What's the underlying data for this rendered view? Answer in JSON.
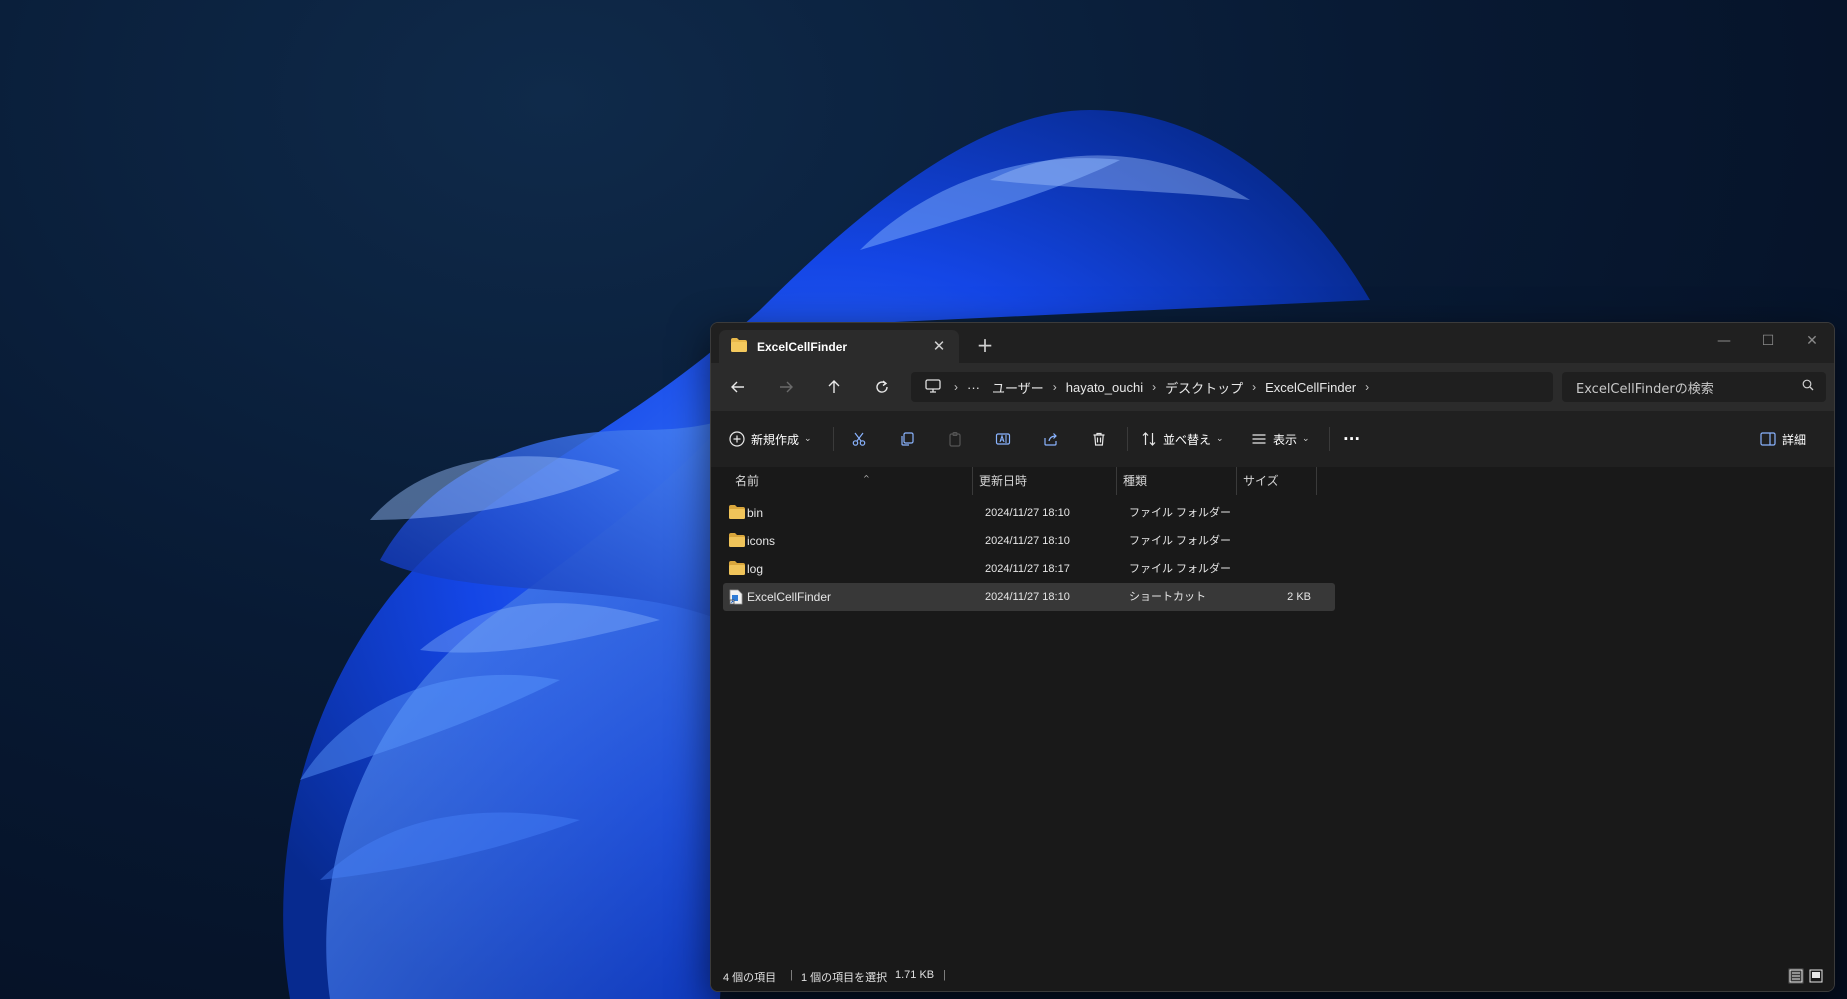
{
  "window": {
    "tab_title": "ExcelCellFinder",
    "new_tab": "+",
    "controls": {
      "minimize": "—",
      "maximize": "☐",
      "close": "✕"
    }
  },
  "navbar": {
    "breadcrumbs": [
      "ユーザー",
      "hayato_ouchi",
      "デスクトップ",
      "ExcelCellFinder"
    ],
    "overflow": "···",
    "search_placeholder": "ExcelCellFinderの検索"
  },
  "toolbar": {
    "new_label": "新規作成",
    "sort_label": "並べ替え",
    "view_label": "表示",
    "more_label": "···",
    "details_label": "詳細"
  },
  "columns": {
    "name": "名前",
    "modified": "更新日時",
    "type": "種類",
    "size": "サイズ"
  },
  "files": [
    {
      "name": "bin",
      "modified": "2024/11/27 18:10",
      "type": "ファイル フォルダー",
      "size": "",
      "icon": "folder-icon"
    },
    {
      "name": "icons",
      "modified": "2024/11/27 18:10",
      "type": "ファイル フォルダー",
      "size": "",
      "icon": "folder-icon"
    },
    {
      "name": "log",
      "modified": "2024/11/27 18:17",
      "type": "ファイル フォルダー",
      "size": "",
      "icon": "folder-icon"
    },
    {
      "name": "ExcelCellFinder",
      "modified": "2024/11/27 18:10",
      "type": "ショートカット",
      "size": "2 KB",
      "icon": "shortcut-icon"
    }
  ],
  "selected_row": 3,
  "status": {
    "item_count": "4 個の項目",
    "selection": "1 個の項目を選択",
    "selection_size": "1.71 KB"
  },
  "colors": {
    "window_bg": "#191919",
    "titlebar_bg": "#202020",
    "navbar_bg": "#2b2b2b",
    "folder_yellow": "#e8b84a",
    "wallpaper_blue": "#1a4cff"
  }
}
